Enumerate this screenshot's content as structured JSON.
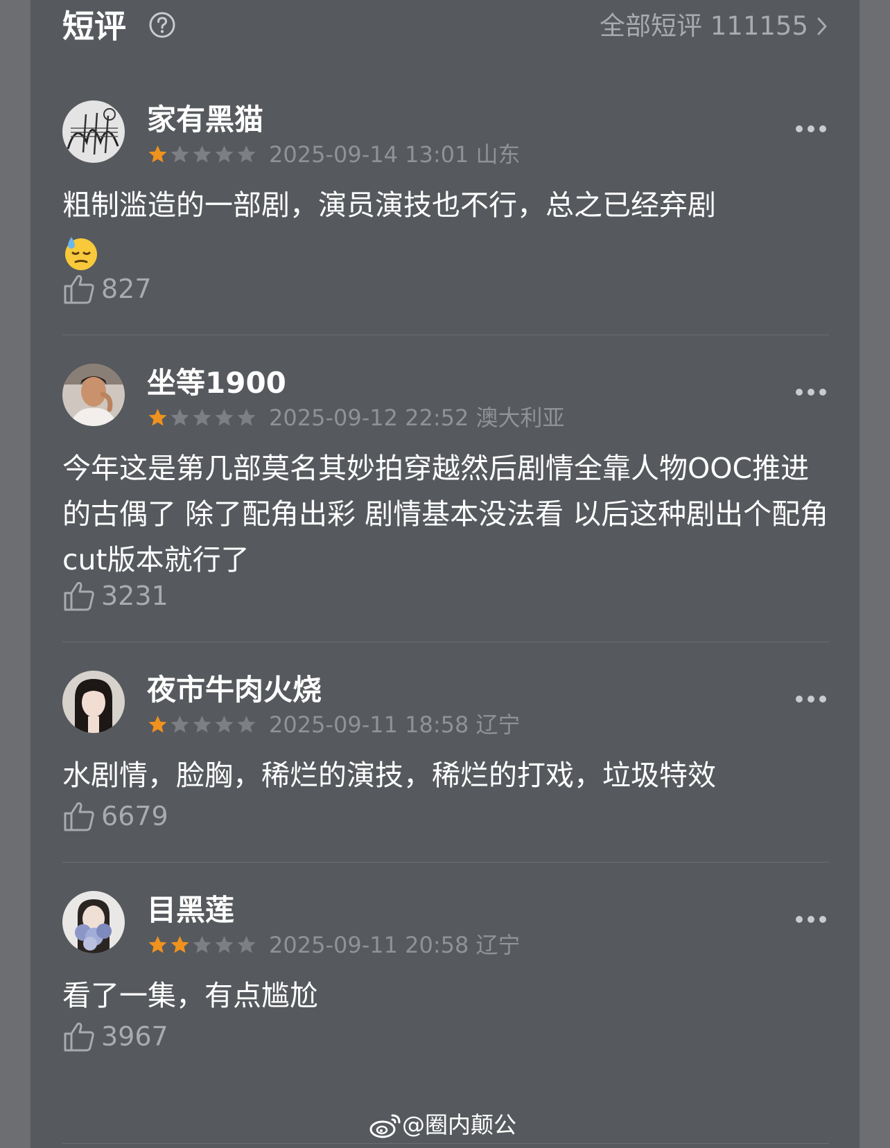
{
  "header": {
    "title": "短评",
    "all_reviews_label": "全部短评 111155"
  },
  "reviews": [
    {
      "name": "家有黑猫",
      "rating": 1,
      "max_rating": 5,
      "time_location": "2025-09-14 13:01 山东",
      "text": "粗制滥造的一部剧，演员演技也不行，总之已经弃剧",
      "emoji": "downcast-sweat-face",
      "likes": "827"
    },
    {
      "name": "坐等1900",
      "rating": 1,
      "max_rating": 5,
      "time_location": "2025-09-12 22:52 澳大利亚",
      "text": "今年这是第几部莫名其妙拍穿越然后剧情全靠人物OOC推进的古偶了 除了配角出彩 剧情基本没法看 以后这种剧出个配角cut版本就行了",
      "likes": "3231"
    },
    {
      "name": "夜市牛肉火烧",
      "rating": 1,
      "max_rating": 5,
      "time_location": "2025-09-11 18:58 辽宁",
      "text": "水剧情，脸胸，稀烂的演技，稀烂的打戏，垃圾特效",
      "likes": "6679"
    },
    {
      "name": "目黑莲",
      "rating": 2,
      "max_rating": 5,
      "time_location": "2025-09-11 20:58 辽宁",
      "text": "看了一集，有点尴尬",
      "likes": "3967"
    }
  ],
  "watermark": "@圈内颠公",
  "colors": {
    "panel": "#56595d",
    "outer": "#6c6e71",
    "star_active": "#f0921e",
    "star_inactive": "#7c7f83"
  }
}
